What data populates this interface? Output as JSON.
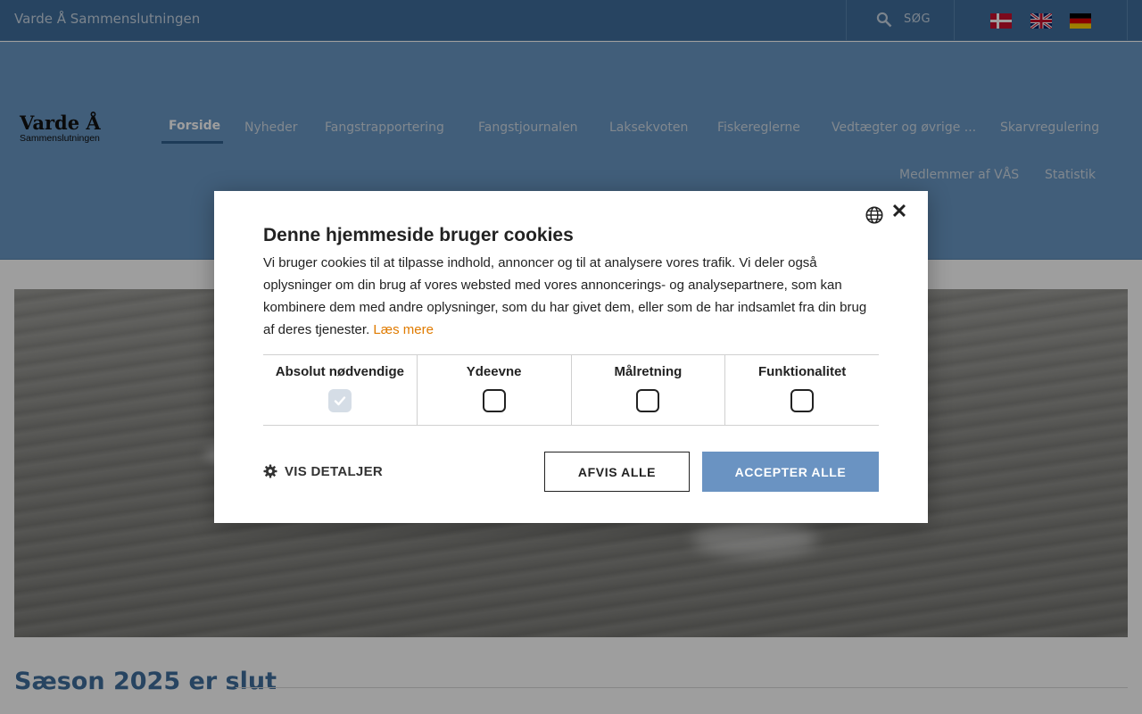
{
  "site": {
    "title": "Varde Å Sammenslutningen",
    "search_label": "SØG",
    "languages": [
      "danish-flag-icon",
      "english-flag-icon",
      "german-flag-icon"
    ]
  },
  "logo": {
    "main": "Varde Å",
    "sub": "Sammenslutningen"
  },
  "nav": {
    "items": [
      {
        "label": "Forside",
        "active": true
      },
      {
        "label": "Nyheder"
      },
      {
        "label": "Fangstrapportering"
      },
      {
        "label": "Fangstjournalen"
      },
      {
        "label": "Laksekvoten"
      },
      {
        "label": "Fiskereglerne"
      },
      {
        "label": "Vedtægter og øvrige ..."
      },
      {
        "label": "Skarvregulering"
      },
      {
        "label": "Medlemmer af VÅS"
      },
      {
        "label": "Statistik"
      }
    ]
  },
  "main": {
    "section_title": "Sæson 2025 er slut"
  },
  "cookie_dialog": {
    "title": "Denne hjemmeside bruger cookies",
    "text": "Vi bruger cookies til at tilpasse indhold, annoncer og til at analysere vores trafik. Vi deler også oplysninger om din brug af vores websted med vores annoncerings- og analysepartnere, som kan kombinere dem med andre oplysninger, som du har givet dem, eller som de har indsamlet fra din brug af deres tjenester.",
    "read_more": "Læs mere",
    "categories": [
      {
        "label": "Absolut nødvendige",
        "checked": true
      },
      {
        "label": "Ydeevne",
        "checked": false
      },
      {
        "label": "Målretning",
        "checked": false
      },
      {
        "label": "Funktionalitet",
        "checked": false
      }
    ],
    "details_label": "VIS DETALJER",
    "reject_label": "AFVIS ALLE",
    "accept_label": "ACCEPTER ALLE"
  },
  "colors": {
    "header_blue": "#6a98c6",
    "topbar_blue": "#3f6f9d",
    "accept_button": "#6a93c2",
    "link_orange": "#e07b00"
  }
}
